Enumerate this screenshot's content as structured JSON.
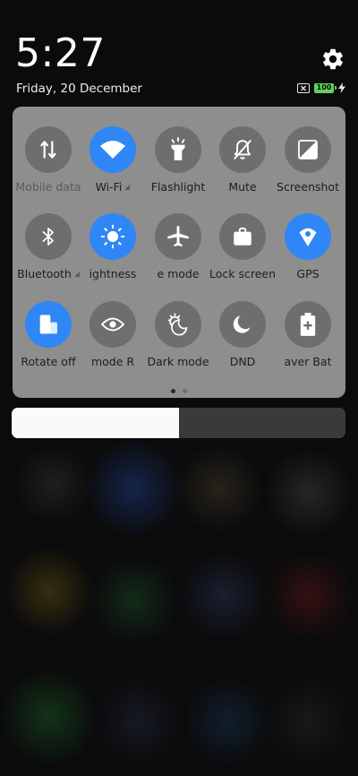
{
  "status": {
    "time": "5:27",
    "date": "Friday, 20 December",
    "battery_level": "100"
  },
  "colors": {
    "accent": "#2f86f6",
    "tile_inactive": "#6e6e6e",
    "panel_bg": "#8e8e8e",
    "battery": "#5fd35f"
  },
  "quick_settings": {
    "page_count": 2,
    "active_page": 1,
    "tiles": [
      {
        "label": "Mobile data",
        "icon": "mobile-data-icon",
        "active": false,
        "dimmed": true,
        "expandable": false
      },
      {
        "label": "Wi-Fi",
        "icon": "wifi-icon",
        "active": true,
        "dimmed": false,
        "expandable": true
      },
      {
        "label": "Flashlight",
        "icon": "flashlight-icon",
        "active": false,
        "dimmed": false,
        "expandable": false
      },
      {
        "label": "Mute",
        "icon": "bell-off-icon",
        "active": false,
        "dimmed": false,
        "expandable": false
      },
      {
        "label": "Screenshot",
        "icon": "screenshot-icon",
        "active": false,
        "dimmed": false,
        "expandable": false
      },
      {
        "label": "Bluetooth",
        "icon": "bluetooth-icon",
        "active": false,
        "dimmed": false,
        "expandable": true
      },
      {
        "label": "ightness",
        "icon": "brightness-icon",
        "active": true,
        "dimmed": false,
        "expandable": false
      },
      {
        "label": "e mode",
        "icon": "airplane-icon",
        "active": false,
        "dimmed": false,
        "expandable": false
      },
      {
        "label": "Lock screen",
        "icon": "lock-screen-icon",
        "active": false,
        "dimmed": false,
        "expandable": false
      },
      {
        "label": "GPS",
        "icon": "location-icon",
        "active": true,
        "dimmed": false,
        "expandable": false
      },
      {
        "label": "Rotate off",
        "icon": "rotate-lock-icon",
        "active": true,
        "dimmed": false,
        "expandable": false
      },
      {
        "label": "mode R",
        "icon": "eye-icon",
        "active": false,
        "dimmed": false,
        "expandable": false
      },
      {
        "label": "Dark mode",
        "icon": "dark-mode-icon",
        "active": false,
        "dimmed": false,
        "expandable": false
      },
      {
        "label": "DND",
        "icon": "moon-icon",
        "active": false,
        "dimmed": false,
        "expandable": false
      },
      {
        "label": "aver Bat",
        "icon": "battery-saver-icon",
        "active": false,
        "dimmed": false,
        "expandable": false
      }
    ]
  },
  "brightness": {
    "level": 0.5
  }
}
